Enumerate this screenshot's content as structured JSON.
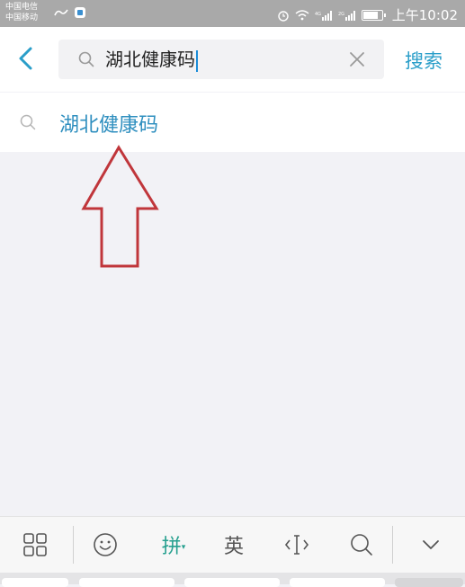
{
  "status_bar": {
    "carrier_1": "中国电信",
    "carrier_2": "中国移动",
    "time": "上午10:02"
  },
  "header": {
    "search_value": "湖北健康码",
    "search_button_label": "搜索"
  },
  "suggestion": {
    "text": "湖北健康码"
  },
  "keyboard": {
    "pinyin_label": "拼",
    "english_label": "英"
  },
  "colors": {
    "accent": "#2a9ec9",
    "annotation_arrow": "#c0363b",
    "ime_active": "#26a08f"
  }
}
